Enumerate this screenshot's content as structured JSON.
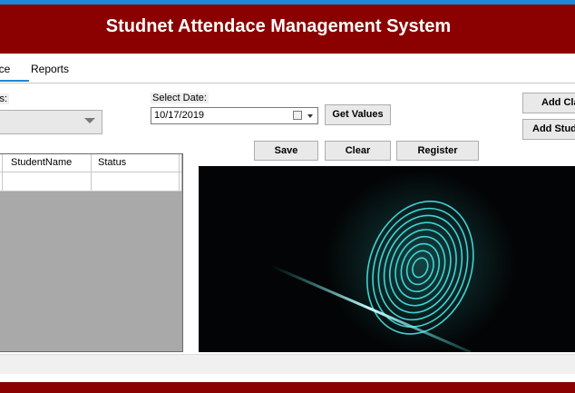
{
  "header": {
    "title": "Studnet Attendace Management System"
  },
  "tabs": [
    {
      "label": "nce",
      "selected": true
    },
    {
      "label": "Reports",
      "selected": false
    }
  ],
  "form": {
    "class_label": "ss:",
    "class_value": "",
    "date_label": "Select Date:",
    "date_value": "10/17/2019"
  },
  "buttons": {
    "get_values": "Get Values",
    "add_class": "Add Cla",
    "add_student": "Add Stud",
    "save": "Save",
    "clear": "Clear",
    "register": "Register"
  },
  "grid": {
    "columns": [
      "StudentName",
      "Status"
    ],
    "rows": []
  },
  "colors": {
    "title_bar": "#8b0000",
    "accent": "#1e88d6",
    "fingerprint_glow": "#3ee6e6"
  },
  "icons": [
    "calendar-icon",
    "chevron-down-icon",
    "fingerprint-icon"
  ]
}
